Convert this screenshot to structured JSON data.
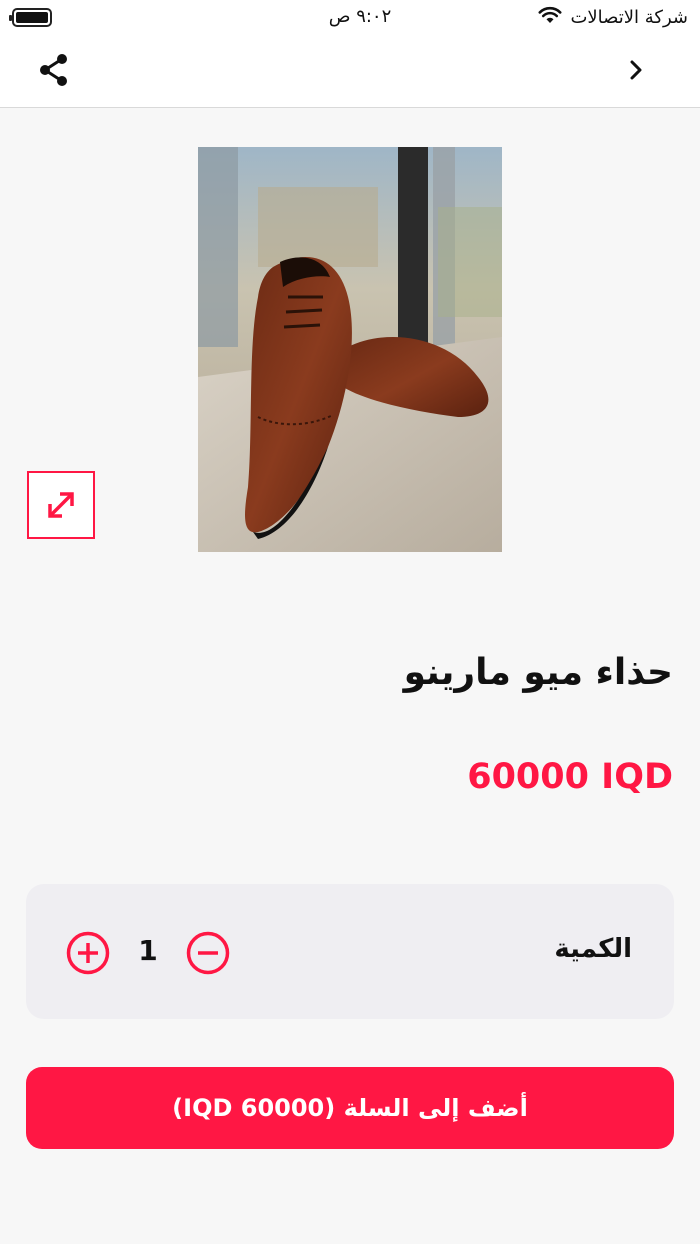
{
  "status_bar": {
    "carrier": "شركة الاتصالات",
    "time": "٩:٠٢ ص"
  },
  "nav": {
    "share_icon": "share-icon",
    "back_icon": "chevron-right-icon"
  },
  "product": {
    "image_alt": "brown leather oxford shoes",
    "expand_icon": "expand-arrows-icon",
    "title": "حذاء ميو مارينو",
    "price": "60000 IQD"
  },
  "quantity": {
    "label": "الكمية",
    "value": "1"
  },
  "add_to_cart": {
    "label": "أضف إلى السلة (IQD 60000)"
  },
  "colors": {
    "accent": "#ff1744",
    "panel": "#efeef2",
    "background": "#f7f7f7"
  }
}
